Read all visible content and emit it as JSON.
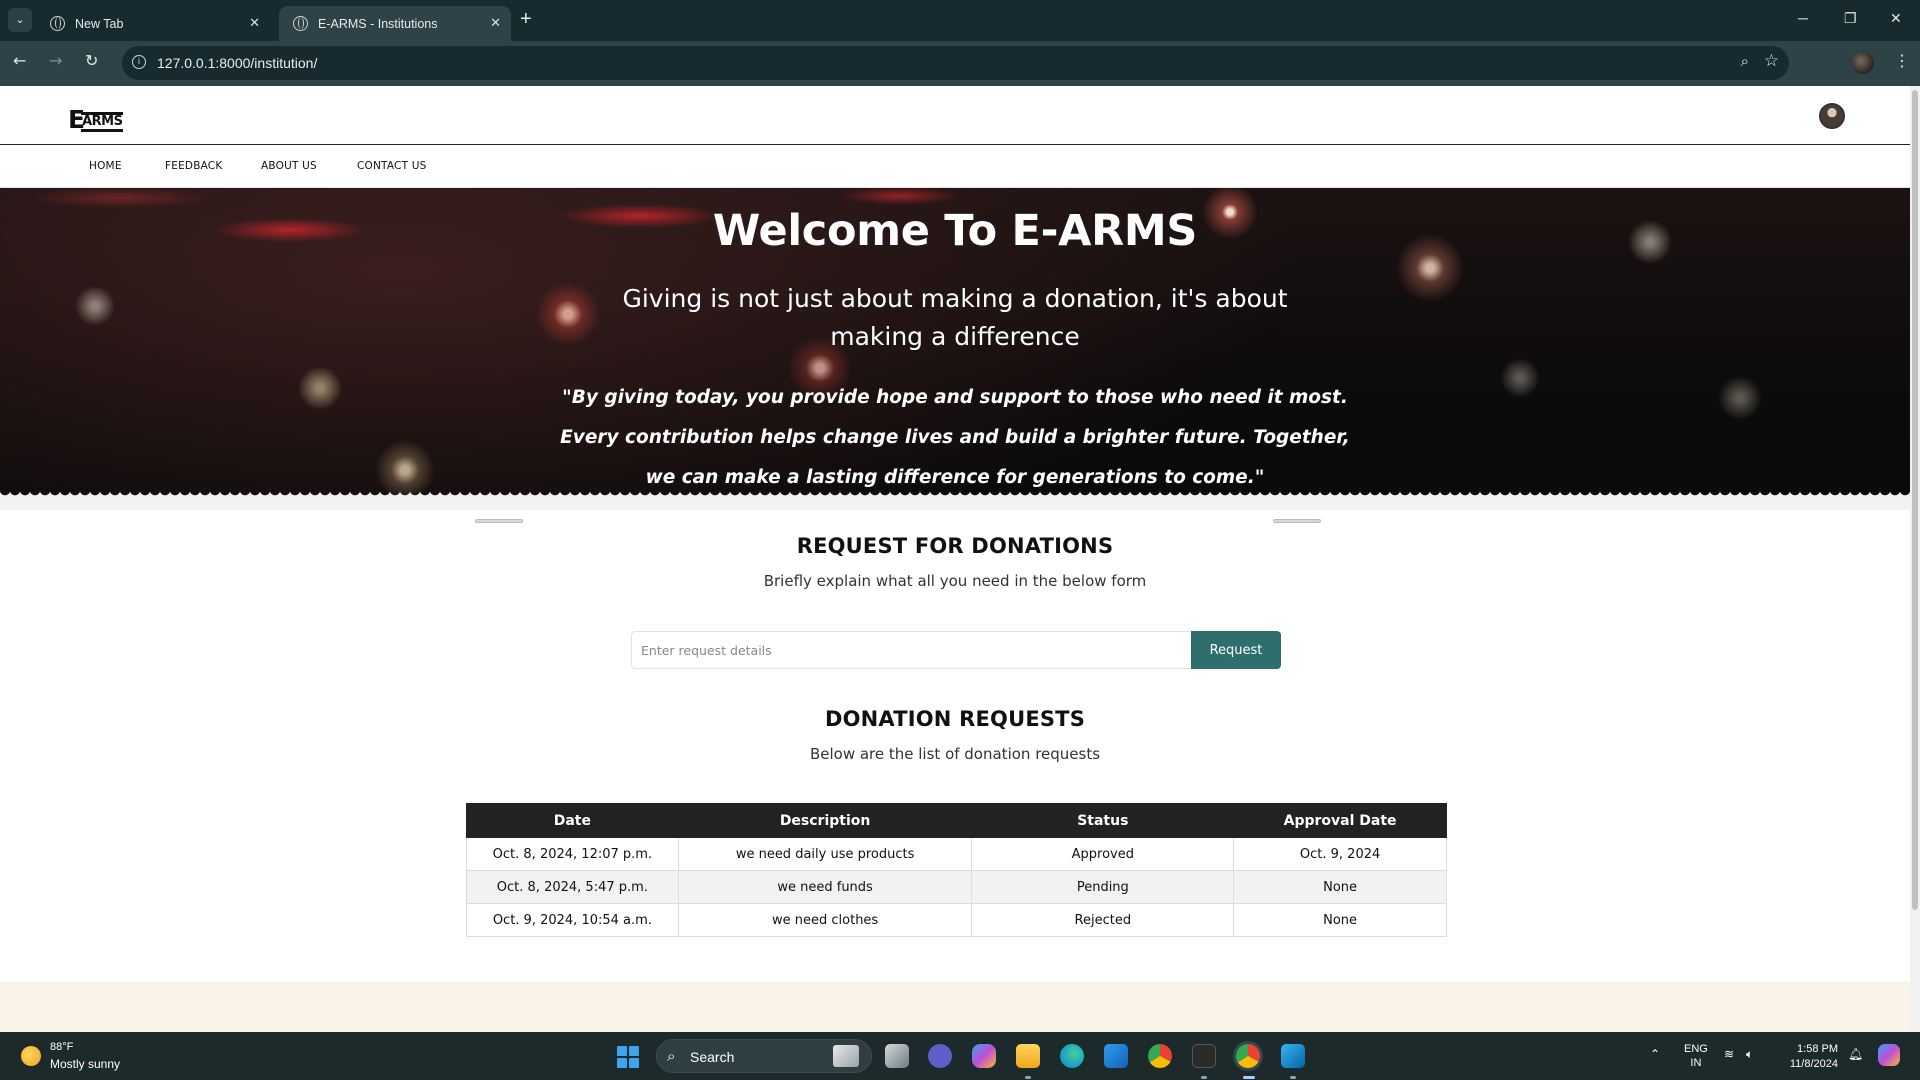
{
  "browser": {
    "tabs": [
      {
        "title": "New Tab",
        "active": false
      },
      {
        "title": "E-ARMS - Institutions",
        "active": true
      }
    ],
    "url": "127.0.0.1:8000/institution/"
  },
  "site": {
    "logo_big": "E",
    "logo_small": "ARMS",
    "nav": [
      "HOME",
      "FEEDBACK",
      "ABOUT US",
      "CONTACT US"
    ]
  },
  "hero": {
    "title": "Welcome To E-ARMS",
    "subtitle": "Giving is not just about making a donation, it's about making a difference",
    "quote": "\"By giving today, you provide hope and support to those who need it most. Every contribution helps change lives and build a brighter future. Together, we can make a lasting difference for generations to come.\""
  },
  "request_section": {
    "title": "REQUEST FOR DONATIONS",
    "subtitle": "Briefly explain what all you need in the below form",
    "input_placeholder": "Enter request details",
    "input_value": "",
    "button_label": "Request"
  },
  "requests_section": {
    "title": "DONATION REQUESTS",
    "subtitle": "Below are the list of donation requests",
    "columns": [
      "Date",
      "Description",
      "Status",
      "Approval Date"
    ],
    "rows": [
      [
        "Oct. 8, 2024, 12:07 p.m.",
        "we need daily use products",
        "Approved",
        "Oct. 9, 2024"
      ],
      [
        "Oct. 8, 2024, 5:47 p.m.",
        "we need funds",
        "Pending",
        "None"
      ],
      [
        "Oct. 9, 2024, 10:54 a.m.",
        "we need clothes",
        "Rejected",
        "None"
      ]
    ]
  },
  "taskbar": {
    "weather_temp": "88°F",
    "weather_desc": "Mostly sunny",
    "search_label": "Search",
    "lang_line1": "ENG",
    "lang_line2": "IN",
    "time": "1:58 PM",
    "date": "11/8/2024"
  },
  "colors": {
    "chrome_dark": "#172a2f",
    "chrome_toolbar": "#2d4348",
    "accent_button": "#2e6f6e",
    "table_header": "#222222",
    "footer_band": "#faf3e8"
  }
}
